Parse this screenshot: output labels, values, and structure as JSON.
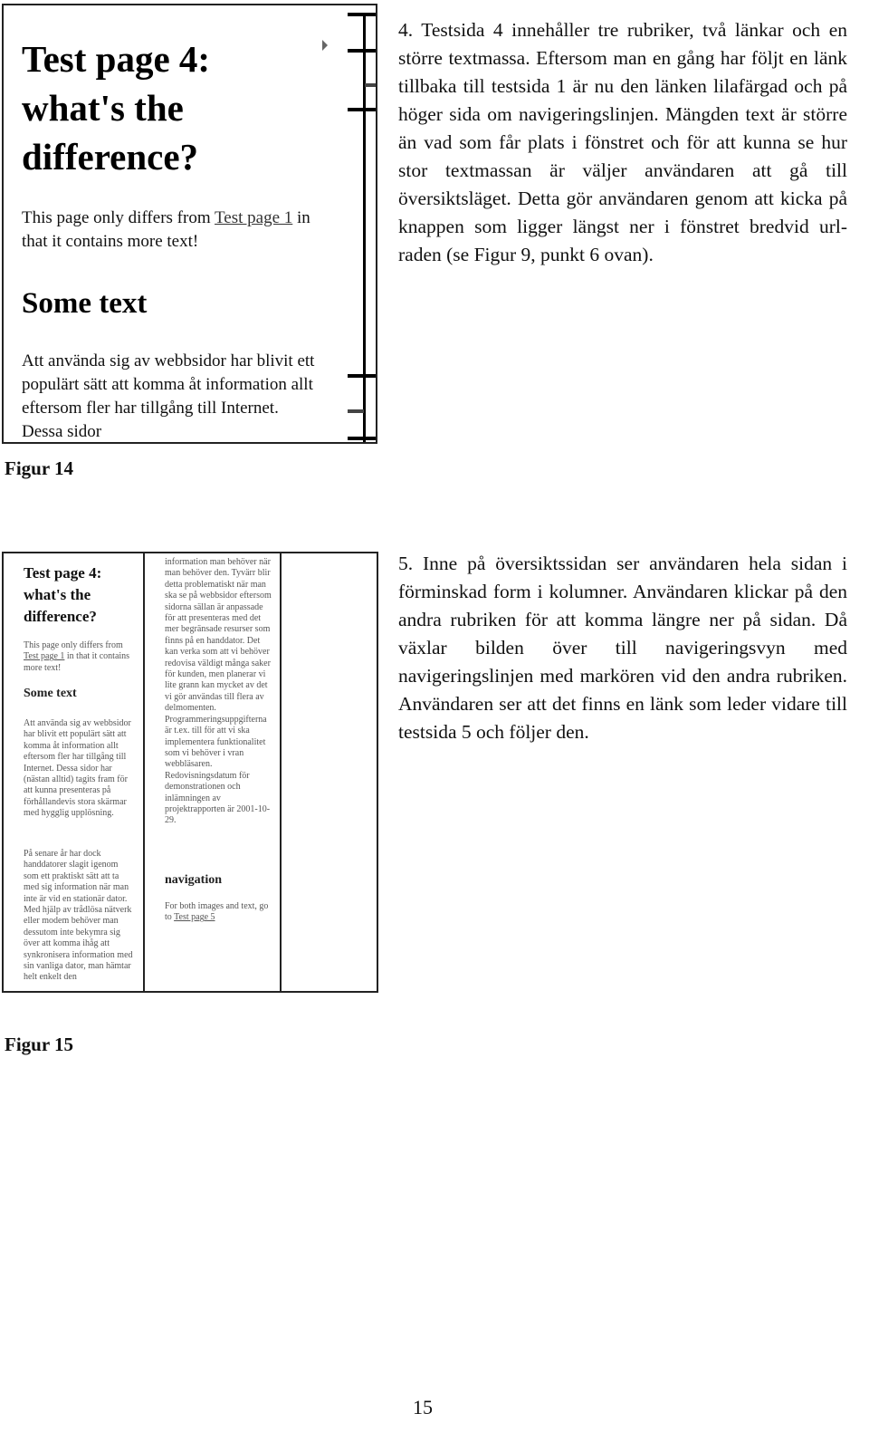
{
  "figure14": {
    "caption": "Figur 14",
    "heading1": "Test page 4: what's the difference?",
    "intro_before": "This page only differs from ",
    "intro_link": "Test page 1",
    "intro_after": " in that it contains more text!",
    "heading2": "Some text",
    "body": "Att använda sig av webbsidor har blivit ett populärt sätt att komma åt information allt eftersom fler har tillgång till Internet. Dessa sidor",
    "navigation_line": {
      "cursor_icon": "triangle-right",
      "cursor_at": "heading 1"
    }
  },
  "figure15": {
    "caption": "Figur 15",
    "heading1": "Test page 4: what's the difference?",
    "intro_before": "This page only differs from ",
    "intro_link": "Test page 1",
    "intro_after": " in that it contains more text!",
    "heading2": "Some text",
    "para1": "Att använda sig av webbsidor har blivit ett populärt sätt att komma åt information allt eftersom fler har tillgång till Internet. Dessa sidor har (nästan alltid) tagits fram för att kunna presenteras på förhållandevis stora skärmar med hygglig upplösning.",
    "para2": "På senare år har dock handdatorer slagit igenom som ett praktiskt sätt att ta med sig information när man inte är vid en stationär dator. Med hjälp av trådlösa nätverk eller modem behöver man dessutom inte bekymra sig över att komma ihåg att synkronisera information med sin vanliga dator, man hämtar helt enkelt den",
    "para3": "information man behöver när man behöver den. Tyvärr blir detta problematiskt när man ska se på webbsidor eftersom sidorna sällan är anpassade för att presenteras med det mer begränsade resurser som finns på en handdator. Det kan verka som att vi behöver redovisa väldigt många saker för kunden, men planerar vi lite grann kan mycket av det vi gör användas till flera av delmomenten. Programmeringsuppgifterna är t.ex. till för att vi ska implementera funktionalitet som vi behöver i vran webbläsaren. Redovisningsdatum för demonstrationen och inlämningen av projektrapporten är 2001-10-29.",
    "heading3": "navigation",
    "nav_before": "For both images and text, go to ",
    "nav_link": "Test page 5"
  },
  "text": {
    "para1": "4. Testsida 4 innehåller tre rubriker, två länkar och en större textmassa. Eftersom man en gång har följt en länk tillbaka till testsida 1 är nu den länken lilafärgad och på höger sida om navigeringslinjen. Mängden text är större än vad som får plats i fönstret och för att kunna se hur stor textmassan är väljer användaren att gå till översiktsläget. Detta gör användaren genom att kicka på knappen som ligger längst ner i fönstret bredvid url-raden (se Figur 9, punkt 6 ovan).",
    "para2": "5. Inne på översiktssidan ser användaren hela sidan i förminskad form i kolumner. Användaren klickar på den andra rubriken för att komma längre ner på sidan. Då växlar bilden över till navigeringsvyn med navigeringslinjen med markören vid den andra rubriken. Användaren ser att det finns en länk som leder vidare till testsida 5 och följer den."
  },
  "page_number": "15"
}
